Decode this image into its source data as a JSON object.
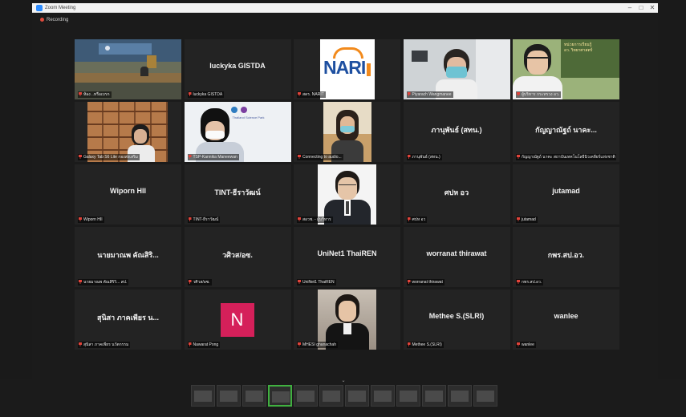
{
  "window": {
    "title": "Zoom Meeting",
    "recording": "Recording",
    "controls": [
      "–",
      "□",
      "✕"
    ]
  },
  "tiles": [
    {
      "name": "ห้อง ..หรือเบรก",
      "label": "",
      "kind": "video",
      "active": true
    },
    {
      "name": "luckyka GISTDA",
      "label": "luckyka GISTDA",
      "kind": "name"
    },
    {
      "name": "สดร. NARIT",
      "label": "NARIT",
      "kind": "logo"
    },
    {
      "name": "Piyarach Wangmanee",
      "label": "",
      "kind": "video"
    },
    {
      "name": "ผู้บริหาร กระทรวง อว.",
      "label": "",
      "kind": "video"
    },
    {
      "name": "Galaxy Tab S6 Lite กองส่งเสริม",
      "label": "",
      "kind": "video"
    },
    {
      "name": "TSP-Kannika Maneewan",
      "label": "",
      "kind": "video"
    },
    {
      "name": "Connecting to audio...",
      "label": "",
      "kind": "video"
    },
    {
      "name": "ภานุพันธ์ (สทน.)",
      "label": "ภานุพันธ์ (สทน.)",
      "kind": "name"
    },
    {
      "name": "กัญญาณัฐถ์ นาคะ สถาบันเทคโนโลยีนิวเคลียร์แห่งชาติ",
      "label": "กัญญาณัฐถ์ นาคะ...",
      "kind": "name"
    },
    {
      "name": "Wiporn HII",
      "label": "Wiporn HII",
      "kind": "name"
    },
    {
      "name": "TINT-ธีราวัฒน์",
      "label": "TINT-ธีราวัฒน์",
      "kind": "name"
    },
    {
      "name": "สอวช. - ผู้บริหาร",
      "label": "",
      "kind": "video"
    },
    {
      "name": "ศปห อว",
      "label": "ศปห อว",
      "kind": "name"
    },
    {
      "name": "jutamad",
      "label": "jutamad",
      "kind": "name"
    },
    {
      "name": "นายมาณพ คัณสิริวิ... สป.",
      "label": "นายมาณพ คัณสิริ...",
      "kind": "name"
    },
    {
      "name": "วศิวส/อซ.",
      "label": "วศิวส/อซ.",
      "kind": "name"
    },
    {
      "name": "UniNet1 ThaiREN",
      "label": "UniNet1 ThaiREN",
      "kind": "name"
    },
    {
      "name": "worranat thirawat",
      "label": "worranat thirawat",
      "kind": "name"
    },
    {
      "name": "กพร.สป.อว.",
      "label": "กพร.สป.อว.",
      "kind": "name"
    },
    {
      "name": "สุนิสา ภาคเพียร นวัตกรรม",
      "label": "สุนิสา ภาคเพียร น...",
      "kind": "name"
    },
    {
      "name": "Nawarat Pong",
      "label": "N",
      "kind": "avatar"
    },
    {
      "name": "MHESI ghanachah",
      "label": "",
      "kind": "video"
    },
    {
      "name": "Methee S.(SLRI)",
      "label": "Methee S.(SLRI)",
      "kind": "name"
    },
    {
      "name": "wanlee",
      "label": "wanlee",
      "kind": "name"
    }
  ],
  "filmstrip": {
    "thumb_count": 12,
    "current_index": 3
  },
  "colors": {
    "active_speaker": "#c8d63a",
    "muted_mic": "#e0433a",
    "avatar_n": "#d5205a",
    "narit_blue": "#1d4fa0",
    "narit_orange": "#f28a1c"
  }
}
